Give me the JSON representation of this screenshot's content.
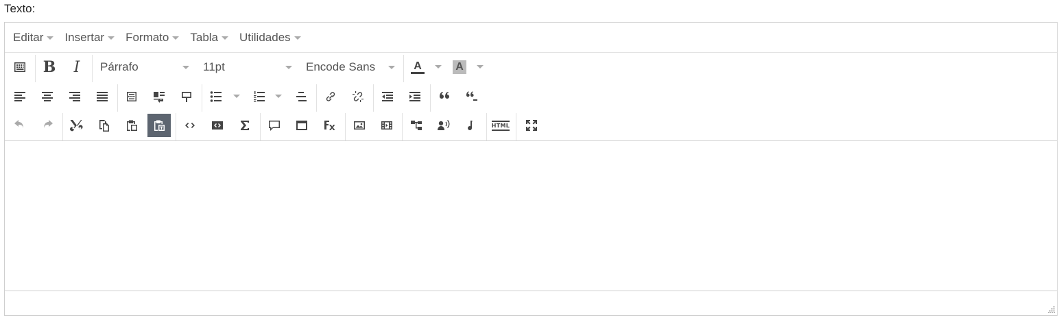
{
  "field": {
    "label": "Texto:"
  },
  "menubar": {
    "items": [
      {
        "label": "Editar"
      },
      {
        "label": "Insertar"
      },
      {
        "label": "Formato"
      },
      {
        "label": "Tabla"
      },
      {
        "label": "Utilidades"
      }
    ]
  },
  "toolbar": {
    "block_format": "Párrafo",
    "font_size": "11pt",
    "font_family": "Encode Sans",
    "bold_glyph": "B",
    "italic_glyph": "I",
    "text_color_glyph": "A",
    "bg_color_glyph": "A",
    "html_label": "HTML",
    "active_button": "paste-text-button",
    "disabled_buttons": [
      "undo-button",
      "redo-button"
    ]
  },
  "colors": {
    "active_button_bg": "#5d6570",
    "icon": "#444444",
    "icon_disabled": "#aaaaaa",
    "border": "#cfcfcf"
  },
  "editor": {
    "content": ""
  }
}
